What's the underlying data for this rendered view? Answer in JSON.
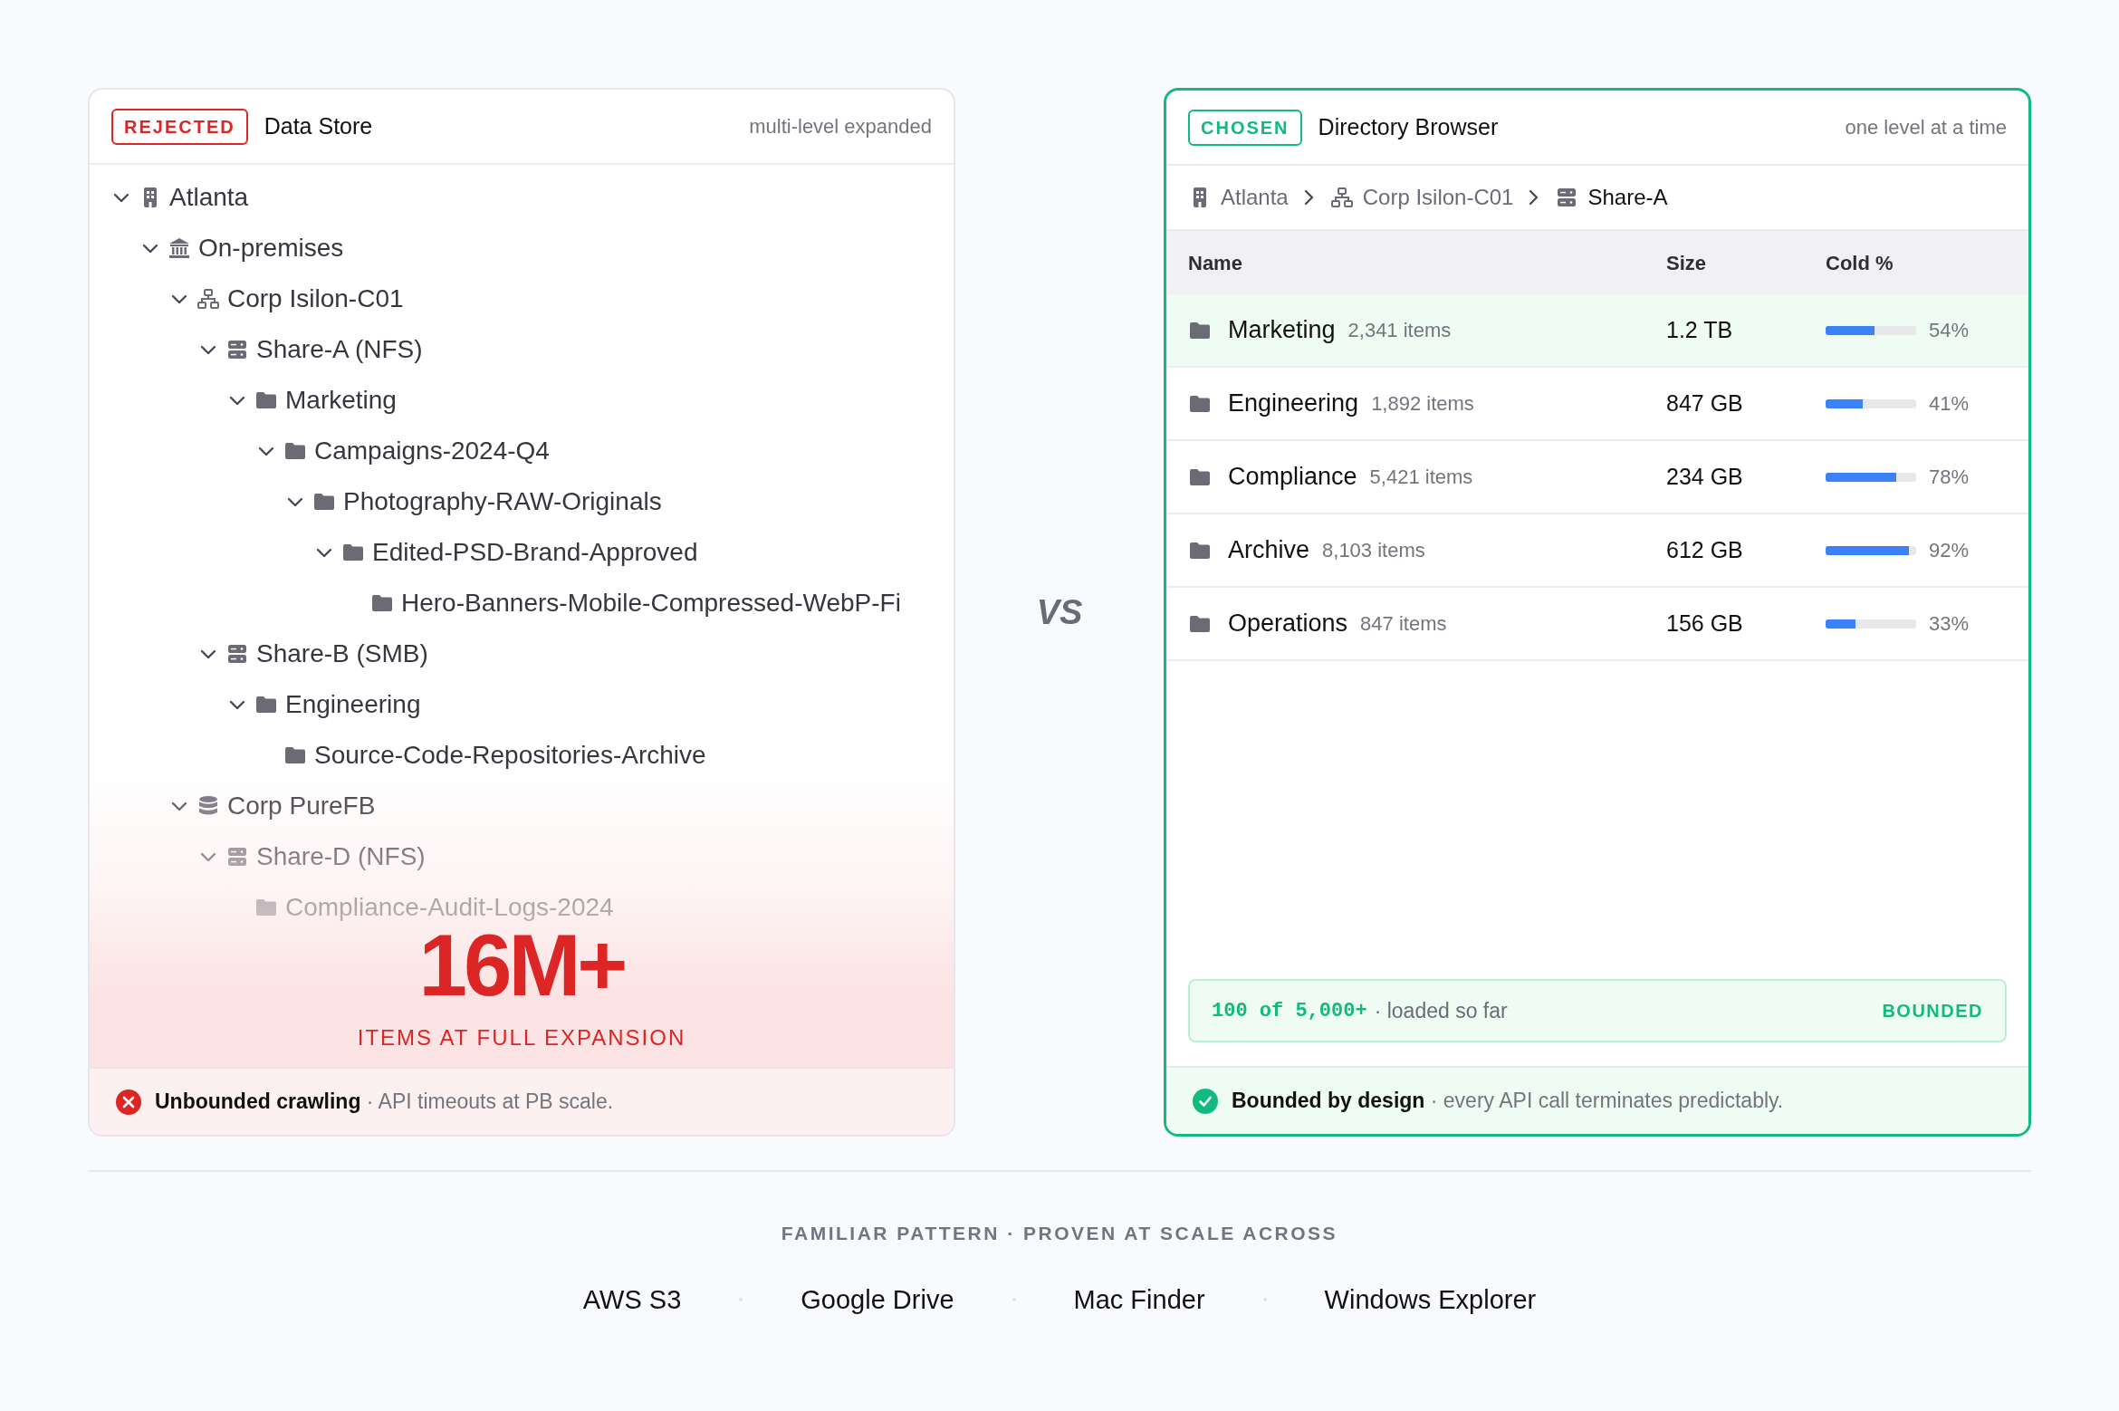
{
  "rejected_panel": {
    "badge": "REJECTED",
    "title": "Data Store",
    "subtitle": "multi-level expanded",
    "tree": [
      {
        "label": "Atlanta",
        "kind": "building",
        "expanded": true,
        "children": [
          {
            "label": "On-premises",
            "kind": "bank",
            "expanded": true,
            "children": [
              {
                "label": "Corp Isilon-C01",
                "kind": "network",
                "expanded": true,
                "children": [
                  {
                    "label": "Share-A (NFS)",
                    "kind": "server",
                    "expanded": true,
                    "children": [
                      {
                        "label": "Marketing",
                        "kind": "folder",
                        "expanded": true,
                        "children": [
                          {
                            "label": "Campaigns-2024-Q4",
                            "kind": "folder",
                            "expanded": true,
                            "children": [
                              {
                                "label": "Photography-RAW-Originals",
                                "kind": "folder",
                                "expanded": true,
                                "children": [
                                  {
                                    "label": "Edited-PSD-Brand-Approved",
                                    "kind": "folder",
                                    "expanded": true,
                                    "children": [
                                      {
                                        "label": "Hero-Banners-Mobile-Compressed-WebP-Fi",
                                        "kind": "folder"
                                      }
                                    ]
                                  }
                                ]
                              }
                            ]
                          }
                        ]
                      }
                    ]
                  },
                  {
                    "label": "Share-B (SMB)",
                    "kind": "server",
                    "expanded": true,
                    "children": [
                      {
                        "label": "Engineering",
                        "kind": "folder",
                        "expanded": true,
                        "children": [
                          {
                            "label": "Source-Code-Repositories-Archive",
                            "kind": "folder"
                          }
                        ]
                      }
                    ]
                  }
                ]
              },
              {
                "label": "Corp PureFB",
                "kind": "database",
                "expanded": true,
                "children": [
                  {
                    "label": "Share-D (NFS)",
                    "kind": "server",
                    "expanded": true,
                    "children": [
                      {
                        "label": "Compliance-Audit-Logs-2024",
                        "kind": "folder"
                      }
                    ]
                  }
                ]
              }
            ]
          }
        ]
      }
    ],
    "stat": {
      "value": "16M+",
      "label": "ITEMS AT FULL EXPANSION"
    },
    "footer": "**Unbounded crawling** · API timeouts at PB scale."
  },
  "separator": "VS",
  "chosen_panel": {
    "badge": "CHOSEN",
    "title": "Directory Browser",
    "subtitle": "one level at a time",
    "breadcrumb": [
      {
        "label": "Atlanta",
        "kind": "building",
        "selected": false
      },
      {
        "label": "Corp Isilon-C01",
        "kind": "network",
        "selected": false
      },
      {
        "label": "Share-A",
        "kind": "server",
        "selected": true
      }
    ],
    "table": {
      "columns": [
        "Name",
        "Size",
        "Cold %"
      ],
      "rows": [
        {
          "name": "Marketing",
          "items": "2,341 items",
          "size": "1.2 TB",
          "level": 0.54,
          "reading": "54%",
          "selected": true
        },
        {
          "name": "Engineering",
          "items": "1,892 items",
          "size": "847 GB",
          "level": 0.41,
          "reading": "41%",
          "selected": false
        },
        {
          "name": "Compliance",
          "items": "5,421 items",
          "size": "234 GB",
          "level": 0.78,
          "reading": "78%",
          "selected": false
        },
        {
          "name": "Archive",
          "items": "8,103 items",
          "size": "612 GB",
          "level": 0.92,
          "reading": "92%",
          "selected": false
        },
        {
          "name": "Operations",
          "items": "847 items",
          "size": "156 GB",
          "level": 0.33,
          "reading": "33%",
          "selected": false
        }
      ]
    },
    "progress": {
      "count": "100 of 5,000+",
      "text": "· loaded so far",
      "tag": "BOUNDED"
    },
    "footer": "**Bounded by design** · every API call terminates predictably."
  },
  "footer": {
    "caption": "FAMILIAR PATTERN · PROVEN AT SCALE ACROSS",
    "examples": [
      "AWS S3",
      "Google Drive",
      "Mac Finder",
      "Windows Explorer"
    ]
  }
}
